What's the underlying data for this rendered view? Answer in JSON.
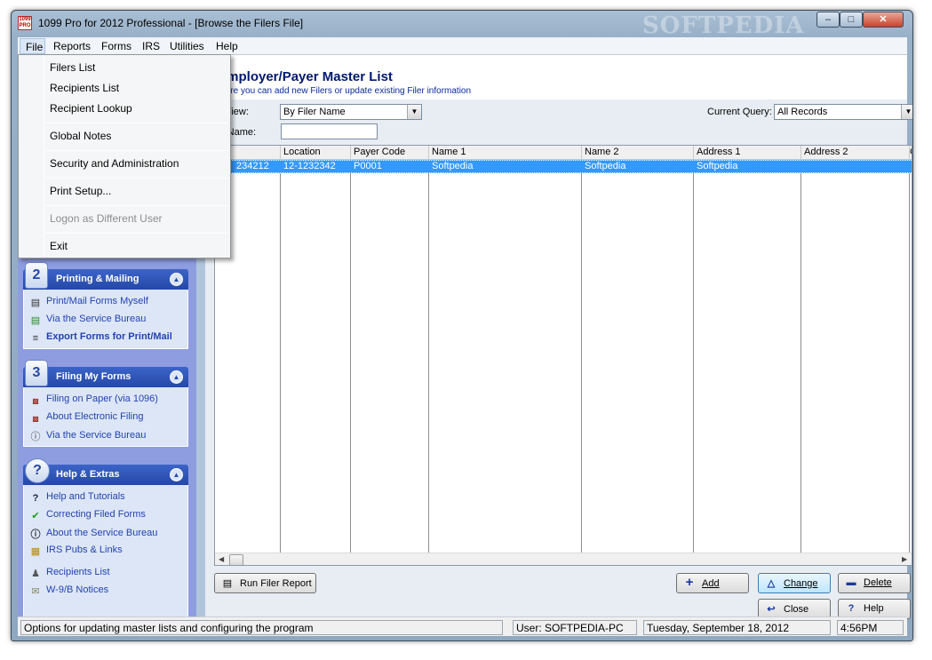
{
  "window": {
    "title": "1099 Pro for 2012 Professional - [Browse the Filers File]",
    "app_icon_text": "1099 PRO",
    "watermark": "SOFTPEDIA",
    "controls": {
      "minimize": "–",
      "maximize": "□",
      "close": "✕"
    }
  },
  "menubar": {
    "items": [
      "File",
      "Reports",
      "Forms",
      "IRS",
      "Utilities",
      "Help"
    ]
  },
  "file_menu": {
    "items": [
      {
        "label": "Filers List",
        "enabled": true
      },
      {
        "label": "Recipients List",
        "enabled": true
      },
      {
        "label": "Recipient Lookup",
        "enabled": true
      },
      {
        "label": "Global Notes",
        "enabled": true
      },
      {
        "label": "Security and Administration",
        "enabled": true
      },
      {
        "label": "Print Setup...",
        "enabled": true
      },
      {
        "label": "Logon as Different User",
        "enabled": false
      },
      {
        "label": "Exit",
        "enabled": true
      }
    ]
  },
  "sidebar": {
    "printing": {
      "number": "2",
      "title": "Printing & Mailing",
      "items": [
        {
          "label": "Print/Mail Forms Myself",
          "icon": "printer-icon"
        },
        {
          "label": "Via the Service Bureau",
          "icon": "printer-green-icon"
        },
        {
          "label": "Export Forms for Print/Mail",
          "icon": "export-icon"
        }
      ]
    },
    "filing": {
      "number": "3",
      "title": "Filing My Forms",
      "items": [
        {
          "label": "Filing on Paper (via 1096)",
          "icon": "form-1096-icon"
        },
        {
          "label": "About Electronic Filing",
          "icon": "irs-icon"
        },
        {
          "label": "Via the Service Bureau",
          "icon": "info-icon"
        }
      ]
    },
    "help": {
      "title": "Help & Extras",
      "items": [
        {
          "label": "Help and Tutorials",
          "icon": "question-icon"
        },
        {
          "label": "Correcting Filed Forms",
          "icon": "checkmark-icon"
        },
        {
          "label": "About the Service Bureau",
          "icon": "question-circle-icon"
        },
        {
          "label": "IRS Pubs & Links",
          "icon": "document-icon"
        },
        {
          "label": "Recipients List",
          "icon": "people-icon"
        },
        {
          "label": "W-9/B Notices",
          "icon": "envelope-icon"
        }
      ]
    }
  },
  "main": {
    "title": "/Employer/Payer Master List",
    "subtitle": "where you can add new Filers or update existing Filer information",
    "current_view_label": "nt View:",
    "current_view_value": "By Filer Name",
    "current_query_label": "Current Query:",
    "current_query_value": "All Records",
    "search_label": "ch Name:",
    "search_value": ""
  },
  "grid": {
    "columns": [
      "",
      "Location",
      "Payer Code",
      "Name 1",
      "Name 2",
      "Address 1",
      "Address 2",
      "C"
    ],
    "rows": [
      [
        "234212",
        "12-1232342",
        "P0001",
        "Softpedia",
        "Softpedia",
        "Softpedia",
        "",
        ""
      ]
    ]
  },
  "buttons": {
    "run_report": "Run Filer Report",
    "add": "Add",
    "change": "Change",
    "delete": "Delete",
    "close": "Close",
    "help": "Help"
  },
  "statusbar": {
    "message": "Options for updating master lists and configuring the program",
    "user": "User: SOFTPEDIA-PC",
    "date": "Tuesday, September 18, 2012",
    "time": "4:56PM"
  }
}
